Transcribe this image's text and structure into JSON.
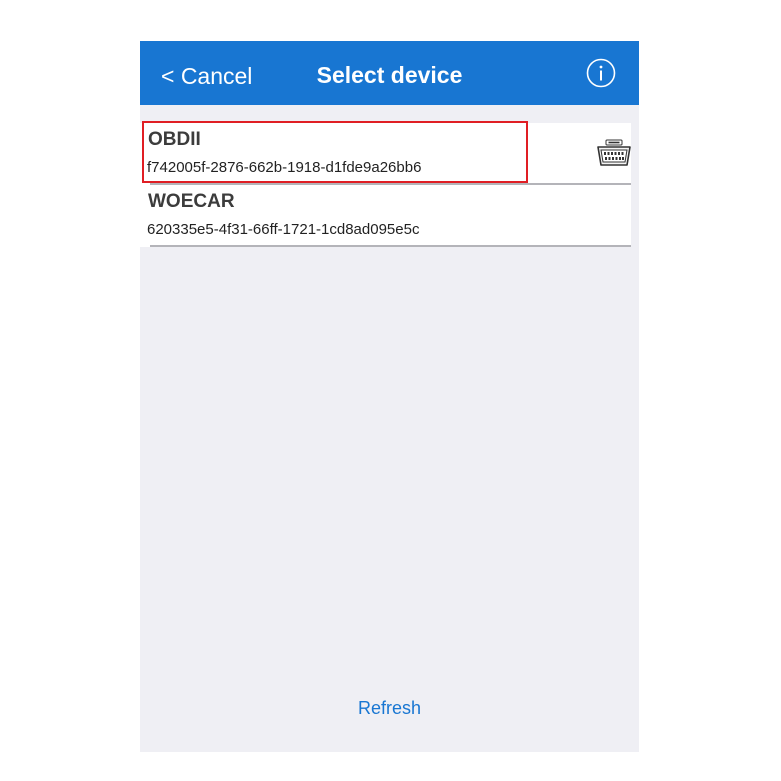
{
  "nav": {
    "cancel_label": "< Cancel",
    "title": "Select device",
    "info_icon": "info-circle-icon"
  },
  "devices": [
    {
      "name": "OBDII",
      "id": "f742005f-2876-662b-1918-d1fde9a26bb6",
      "icon": "obd-connector-icon",
      "highlighted": true
    },
    {
      "name": "WOECAR",
      "id": "620335e5-4f31-66ff-1721-1cd8ad095e5c",
      "highlighted": false
    }
  ],
  "footer": {
    "refresh_label": "Refresh"
  },
  "colors": {
    "nav_background": "#1876d2",
    "screen_background": "#efeff4",
    "highlight_border": "#e01e24",
    "link": "#1876d2"
  }
}
